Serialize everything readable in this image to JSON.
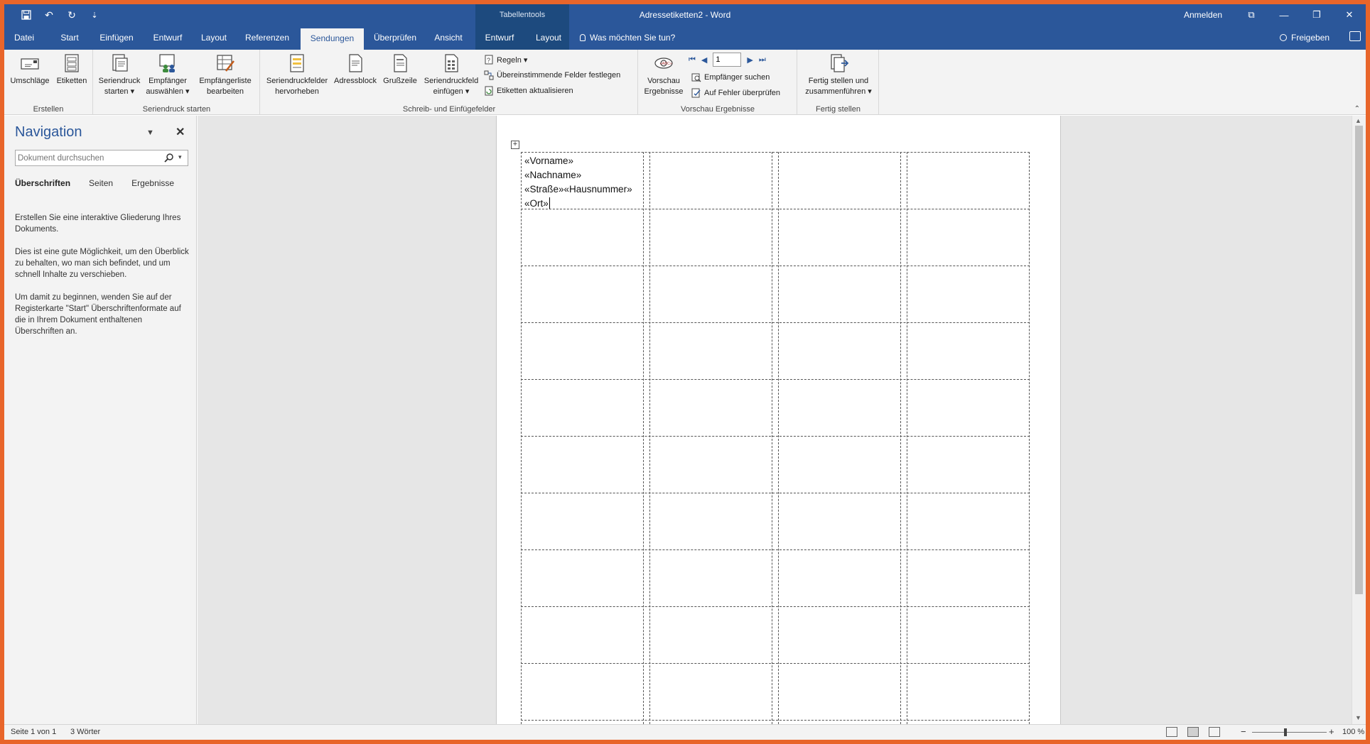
{
  "titlebar": {
    "contextual_title": "Tabellentools",
    "doc_title": "Adressetiketten2  -  Word",
    "signin": "Anmelden",
    "qat_save": "💾",
    "qat_undo": "↶",
    "qat_redo": "↻",
    "qat_customize": "⇣",
    "restore_ribbon": "⧉",
    "minimize": "—",
    "maximize": "❐",
    "close": "✕"
  },
  "tabs": [
    {
      "label": "Datei"
    },
    {
      "label": "Start"
    },
    {
      "label": "Einfügen"
    },
    {
      "label": "Entwurf"
    },
    {
      "label": "Layout"
    },
    {
      "label": "Referenzen"
    },
    {
      "label": "Sendungen"
    },
    {
      "label": "Überprüfen"
    },
    {
      "label": "Ansicht"
    },
    {
      "label": "Entwurf"
    },
    {
      "label": "Layout"
    }
  ],
  "tellme": "Was möchten Sie tun?",
  "share": "Freigeben",
  "ribbon": {
    "groups": {
      "erstellen": "Erstellen",
      "seriendruck": "Seriendruck starten",
      "schreib": "Schreib- und Einfügefelder",
      "vorschau": "Vorschau Ergebnisse",
      "fertig": "Fertig stellen"
    },
    "umschlaege": "Umschläge",
    "etiketten": "Etiketten",
    "seriendruck_starten_1": "Seriendruck",
    "seriendruck_starten_2": "starten ▾",
    "empfaenger_1": "Empfänger",
    "empfaenger_2": "auswählen ▾",
    "empfaengerliste_1": "Empfängerliste",
    "empfaengerliste_2": "bearbeiten",
    "felder_hervorheben_1": "Seriendruckfelder",
    "felder_hervorheben_2": "hervorheben",
    "adressblock": "Adressblock",
    "grusszeile": "Grußzeile",
    "feld_einfuegen_1": "Seriendruckfeld",
    "feld_einfuegen_2": "einfügen ▾",
    "regeln": "Regeln ▾",
    "felder_festlegen": "Übereinstimmende Felder festlegen",
    "etiketten_aktualisieren": "Etiketten aktualisieren",
    "vorschau_1": "Vorschau",
    "vorschau_2": "Ergebnisse",
    "record_number": "1",
    "empfaenger_suchen": "Empfänger suchen",
    "fehler_pruefen": "Auf Fehler überprüfen",
    "fertig_1": "Fertig stellen und",
    "fertig_2": "zusammenführen ▾",
    "collapse": "⌃"
  },
  "nav": {
    "title": "Navigation",
    "dropdown": "▼",
    "close": "✕",
    "search_placeholder": "Dokument durchsuchen",
    "search_drop": "▾",
    "tabs": [
      "Überschriften",
      "Seiten",
      "Ergebnisse"
    ],
    "help": [
      "Erstellen Sie eine interaktive Gliederung Ihres Dokuments.",
      "Dies ist eine gute Möglichkeit, um den Überblick zu behalten, wo man sich befindet, und um schnell Inhalte zu verschieben.",
      "Um damit zu beginnen, wenden Sie auf der Registerkarte \"Start\" Überschriftenformate auf die in Ihrem Dokument enthaltenen Überschriften an."
    ]
  },
  "document": {
    "table_handle": "+",
    "fields": [
      "«Vorname»",
      "«Nachname»",
      "«Straße»«Hausnummer»",
      "«Ort»"
    ]
  },
  "scrollbar": {
    "up": "▲",
    "down": "▼"
  },
  "status": {
    "page": "Seite 1 von 1",
    "words": "3 Wörter",
    "zoom_minus": "−",
    "zoom_plus": "+",
    "zoom": "100 %",
    "zoom_fraction": 0.45
  },
  "colors": {
    "accent": "#2b579a",
    "contextual": "#1d4a7e",
    "frame": "#e8652a"
  }
}
